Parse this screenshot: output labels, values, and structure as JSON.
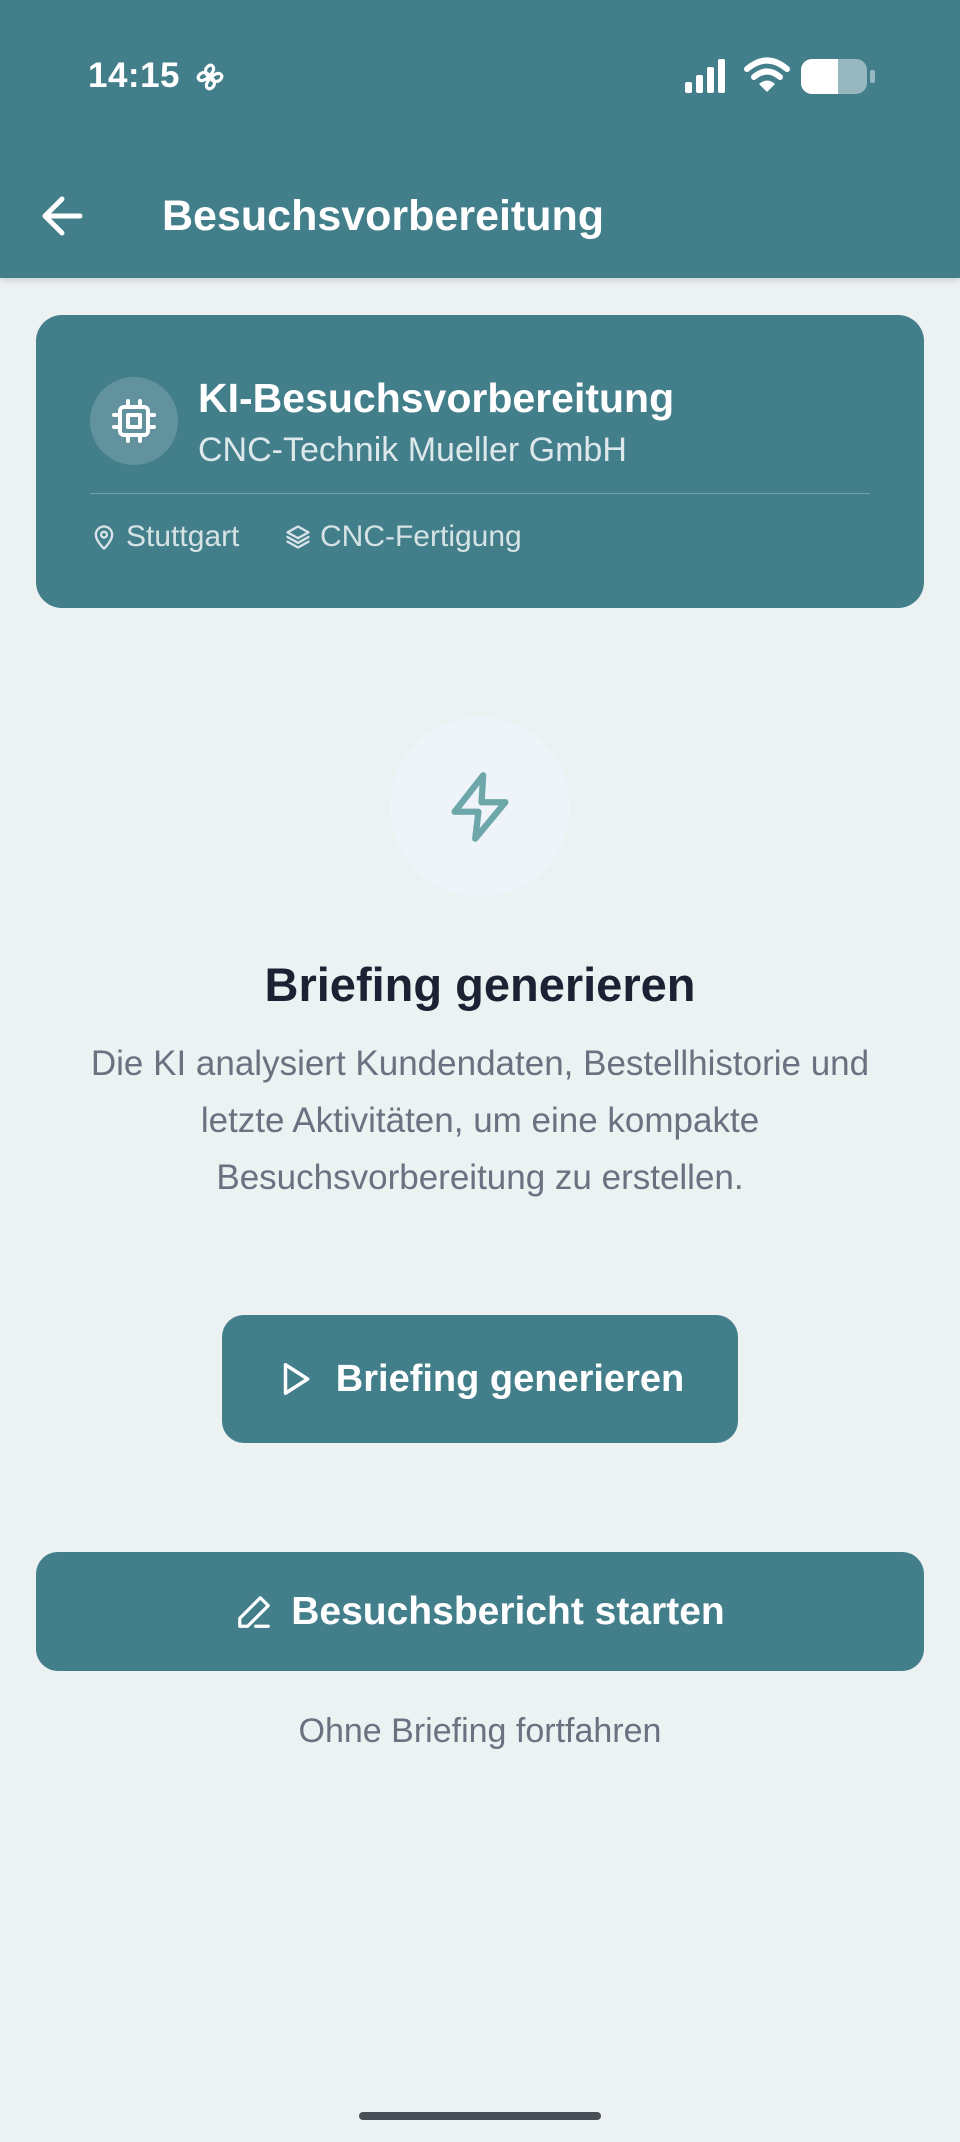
{
  "status_bar": {
    "time": "14:15"
  },
  "header": {
    "title": "Besuchsvorbereitung"
  },
  "info_card": {
    "title": "KI-Besuchsvorbereitung",
    "company": "CNC-Technik Mueller GmbH",
    "location": "Stuttgart",
    "industry": "CNC-Fertigung"
  },
  "briefing": {
    "heading": "Briefing generieren",
    "description": "Die KI analysiert Kundendaten, Bestellhistorie und letzte Aktivitäten, um eine kompakte Besuchsvorbereitung zu erstellen.",
    "generate_button_label": "Briefing generieren"
  },
  "actions": {
    "report_button_label": "Besuchsbericht starten",
    "skip_link_label": "Ohne Briefing fortfahren"
  },
  "colors": {
    "primary": "#437e8b",
    "background": "#ecf1f1",
    "heading": "#1c2233",
    "muted_text": "#6a7180",
    "icon_circle": "#eef4fa",
    "bolt_icon": "#6ea7aa"
  },
  "icons": {
    "status_fan": "fan-icon",
    "signal": "signal-icon",
    "wifi": "wifi-icon",
    "battery": "battery-icon",
    "back": "arrow-left-icon",
    "chip": "cpu-chip-icon",
    "location": "map-pin-icon",
    "industry": "layers-icon",
    "bolt": "lightning-bolt-icon",
    "play": "play-icon",
    "pencil": "pencil-icon"
  }
}
